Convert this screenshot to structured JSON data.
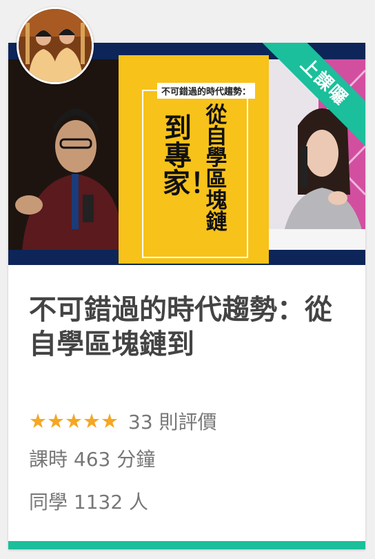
{
  "course": {
    "thumbnail": {
      "subtitle": "不可錯過的時代趨勢：",
      "headline_col1": "從自學區塊鏈",
      "headline_col2": "到專家！",
      "ribbon": "上課囉"
    },
    "title": "不可錯過的時代趨勢：從自學區塊鏈到",
    "rating": {
      "stars": 5,
      "star_glyph": "★",
      "count_text": "33 則評價"
    },
    "duration_text": "課時 463 分鐘",
    "students_text": "同學 1132 人"
  },
  "colors": {
    "accent": "#1bbf9c",
    "star": "#f5a623",
    "poster": "#f7c21a",
    "thumb_bg": "#13306e",
    "text_title": "#444444",
    "text_meta": "#777777"
  }
}
